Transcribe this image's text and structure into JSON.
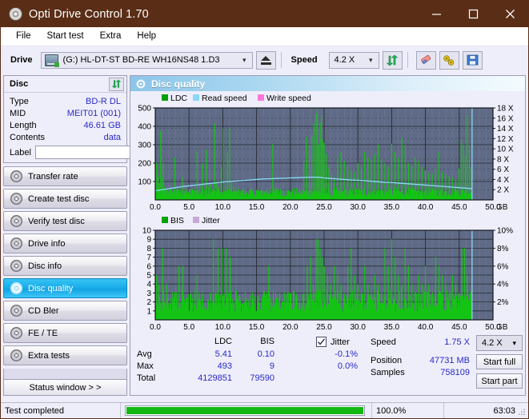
{
  "window": {
    "title": "Opti Drive Control 1.70",
    "icon": "disc-icon",
    "minimize": "minimize",
    "maximize": "maximize",
    "close": "close"
  },
  "menu": {
    "items": [
      "File",
      "Start test",
      "Extra",
      "Help"
    ]
  },
  "toolbar": {
    "drive_label": "Drive",
    "drive_value": "(G:)   HL-DT-ST BD-RE  WH16NS48 1.D3",
    "eject_icon": "eject-icon",
    "speed_label": "Speed",
    "speed_value": "4.2 X",
    "refresh_icon": "refresh-icon",
    "erase_icon": "eraser-icon",
    "tools_icon": "wrench-icon",
    "save_icon": "floppy-save-icon"
  },
  "disc_panel": {
    "title": "Disc",
    "refresh_icon": "refresh-icon",
    "rows": [
      {
        "key": "Type",
        "value": "BD-R DL"
      },
      {
        "key": "MID",
        "value": "MEIT01 (001)"
      },
      {
        "key": "Length",
        "value": "46.61 GB"
      },
      {
        "key": "Contents",
        "value": "data"
      }
    ],
    "label_key": "Label",
    "label_value": "",
    "label_placeholder": "",
    "disc_icon": "cd-icon"
  },
  "nav": {
    "items": [
      {
        "label": "Transfer rate",
        "selected": false
      },
      {
        "label": "Create test disc",
        "selected": false
      },
      {
        "label": "Verify test disc",
        "selected": false
      },
      {
        "label": "Drive info",
        "selected": false
      },
      {
        "label": "Disc info",
        "selected": false
      },
      {
        "label": "Disc quality",
        "selected": true
      },
      {
        "label": "CD Bler",
        "selected": false
      },
      {
        "label": "FE / TE",
        "selected": false
      },
      {
        "label": "Extra tests",
        "selected": false
      }
    ],
    "status_window": "Status window > >"
  },
  "content": {
    "title": "Disc quality",
    "icon": "disc-quality-icon"
  },
  "stats": {
    "col_ldc": "LDC",
    "col_bis": "BIS",
    "rows": [
      {
        "label": "Avg",
        "ldc": "5.41",
        "bis": "0.10"
      },
      {
        "label": "Max",
        "ldc": "493",
        "bis": "9"
      },
      {
        "label": "Total",
        "ldc": "4129851",
        "bis": "79590"
      }
    ],
    "jitter_label": "Jitter",
    "jitter_checked": true,
    "jitter_values": [
      "-0.1%",
      "0.0%"
    ],
    "speed_label": "Speed",
    "speed_value": "1.75 X",
    "position_label": "Position",
    "position_value": "47731 MB",
    "samples_label": "Samples",
    "samples_value": "758109",
    "speed_select": "4.2 X",
    "start_full": "Start full",
    "start_part": "Start part"
  },
  "statusbar": {
    "message": "Test completed",
    "progress_pct": 100.0,
    "progress_text": "100.0%",
    "elapsed": "63:03"
  },
  "colors": {
    "title_bar": "#5a2d16",
    "accent_selected": "#1aaeea",
    "value_blue": "#2929c8",
    "plot_bg": "#5f6b86",
    "series_green": "#14c414",
    "series_cyan": "#88d8f8",
    "series_pink": "#ff77dd",
    "jitter_violet": "#c9a8d8",
    "progress_green": "#12b812"
  },
  "chart_data": [
    {
      "type": "area",
      "name": "quality-chart-ldc",
      "title": "",
      "xlabel": "GB",
      "ylabel": "",
      "xlim": [
        0,
        50
      ],
      "ylim": [
        0,
        500
      ],
      "y2lim": [
        0,
        18
      ],
      "grid": true,
      "xticks": [
        0.0,
        5.0,
        10.0,
        15.0,
        20.0,
        25.0,
        30.0,
        35.0,
        40.0,
        45.0,
        50.0
      ],
      "xticklabels": [
        "0.0",
        "5.0",
        "10.0",
        "15.0",
        "20.0",
        "25.0",
        "30.0",
        "35.0",
        "40.0",
        "45.0",
        "50.0"
      ],
      "xunit": "GB",
      "yticks": [
        100,
        200,
        300,
        400,
        500
      ],
      "yticklabels": [
        "100",
        "200",
        "300",
        "400",
        "500"
      ],
      "y2ticks": [
        2,
        4,
        6,
        8,
        10,
        12,
        14,
        16,
        18
      ],
      "y2ticklabels": [
        "2 X",
        "4 X",
        "6 X",
        "8 X",
        "10 X",
        "12 X",
        "14 X",
        "16 X",
        "18 X"
      ],
      "legend": [
        {
          "label": "LDC",
          "color": "#00a000"
        },
        {
          "label": "Read speed",
          "color": "#88d8f8"
        },
        {
          "label": "Write speed",
          "color": "#ff77dd"
        }
      ],
      "legend_position": "top-left",
      "data_end_x": 46.9,
      "series": [
        {
          "name": "LDC",
          "color": "#14c414",
          "type": "spikes",
          "baseline": 20,
          "x": [
            0.2,
            0.4,
            0.6,
            0.8,
            1.0,
            1.2,
            1.4,
            1.6,
            1.8,
            2.0,
            2.3,
            2.6,
            2.9,
            3.2,
            3.5,
            3.8,
            4.1,
            4.4,
            4.7,
            5.0,
            5.4,
            5.8,
            6.2,
            6.6,
            7.0,
            7.3,
            7.6,
            7.9,
            8.2,
            8.5,
            8.8,
            9.1,
            9.3,
            9.5,
            9.8,
            10.1,
            10.4,
            10.7,
            11.0,
            11.3,
            11.6,
            11.9,
            12.2,
            12.6,
            13.0,
            13.5,
            14.0,
            14.5,
            15.0,
            15.4,
            15.8,
            16.2,
            16.6,
            17.0,
            17.4,
            17.8,
            18.2,
            18.6,
            19.0,
            19.5,
            20.0,
            20.4,
            20.8,
            21.2,
            21.6,
            22.0,
            22.4,
            22.8,
            23.2,
            23.5,
            23.8,
            24.0,
            24.2,
            24.4,
            24.6,
            24.8,
            25.0,
            25.3,
            25.7,
            26.1,
            26.5,
            27.0,
            27.5,
            28.0,
            28.5,
            29.0,
            29.5,
            30.0,
            30.5,
            31.0,
            31.5,
            32.0,
            32.5,
            33.0,
            33.5,
            34.0,
            34.5,
            35.0,
            35.5,
            36.0,
            36.5,
            37.0,
            37.5,
            38.0,
            38.5,
            39.0,
            39.5,
            40.0,
            40.5,
            41.0,
            41.5,
            42.0,
            42.5,
            43.0,
            43.5,
            44.0,
            44.5,
            45.0,
            45.3,
            45.6,
            45.9,
            46.2,
            46.5,
            46.8
          ],
          "y": [
            200,
            130,
            90,
            375,
            120,
            200,
            70,
            60,
            55,
            50,
            48,
            45,
            230,
            60,
            50,
            45,
            120,
            55,
            50,
            45,
            60,
            55,
            260,
            80,
            200,
            60,
            270,
            70,
            90,
            60,
            415,
            100,
            70,
            60,
            180,
            390,
            70,
            260,
            395,
            95,
            70,
            60,
            55,
            50,
            45,
            40,
            38,
            36,
            55,
            50,
            48,
            45,
            60,
            55,
            305,
            70,
            60,
            55,
            50,
            48,
            45,
            42,
            40,
            38,
            36,
            210,
            340,
            300,
            350,
            420,
            470,
            495,
            300,
            420,
            460,
            330,
            310,
            250,
            180,
            140,
            120,
            230,
            260,
            210,
            180,
            160,
            150,
            200,
            180,
            260,
            230,
            220,
            250,
            300,
            220,
            200,
            180,
            305,
            260,
            230,
            340,
            300,
            200,
            180,
            230,
            210,
            180,
            160,
            150,
            140,
            170,
            260,
            150,
            140,
            130,
            120,
            110,
            170,
            330,
            300,
            240,
            460,
            300,
            180
          ]
        },
        {
          "name": "Read speed",
          "color": "#88d8f8",
          "type": "line",
          "axis": "y2",
          "x": [
            0.0,
            1.0,
            2.0,
            3.0,
            4.0,
            5.0,
            6.0,
            7.0,
            8.0,
            9.0,
            10.0,
            11.0,
            12.0,
            13.0,
            14.0,
            15.0,
            16.0,
            17.0,
            18.0,
            19.0,
            20.0,
            21.0,
            22.0,
            23.0,
            23.8,
            24.5,
            25.0,
            26.0,
            27.0,
            28.0,
            29.0,
            30.0,
            31.0,
            32.0,
            33.0,
            34.0,
            35.0,
            36.0,
            37.0,
            38.0,
            39.0,
            40.0,
            41.0,
            42.0,
            43.0,
            44.0,
            45.0,
            46.0,
            46.8
          ],
          "y": [
            1.8,
            2.0,
            2.2,
            2.4,
            2.6,
            2.75,
            2.9,
            3.05,
            3.2,
            3.35,
            3.5,
            3.6,
            3.7,
            3.8,
            3.9,
            4.0,
            4.1,
            4.15,
            4.2,
            4.25,
            4.3,
            4.35,
            4.4,
            4.45,
            4.45,
            4.4,
            4.3,
            4.2,
            4.1,
            4.0,
            3.9,
            3.85,
            3.75,
            3.65,
            3.55,
            3.45,
            3.4,
            3.3,
            3.2,
            3.1,
            3.0,
            2.9,
            2.8,
            2.7,
            2.6,
            2.5,
            2.4,
            2.3,
            2.2
          ]
        },
        {
          "name": "end-marker",
          "color": "#88d8f8",
          "type": "vline",
          "x": 46.9
        }
      ]
    },
    {
      "type": "area",
      "name": "quality-chart-bis",
      "title": "",
      "xlabel": "GB",
      "ylabel": "",
      "xlim": [
        0,
        50
      ],
      "ylim": [
        0,
        10
      ],
      "y2lim": [
        0,
        10
      ],
      "grid": true,
      "xticks": [
        0.0,
        5.0,
        10.0,
        15.0,
        20.0,
        25.0,
        30.0,
        35.0,
        40.0,
        45.0,
        50.0
      ],
      "xticklabels": [
        "0.0",
        "5.0",
        "10.0",
        "15.0",
        "20.0",
        "25.0",
        "30.0",
        "35.0",
        "40.0",
        "45.0",
        "50.0"
      ],
      "xunit": "GB",
      "yticks": [
        1,
        2,
        3,
        4,
        5,
        6,
        7,
        8,
        9,
        10
      ],
      "yticklabels": [
        "1",
        "2",
        "3",
        "4",
        "5",
        "6",
        "7",
        "8",
        "9",
        "10"
      ],
      "y2ticks": [
        2,
        4,
        6,
        8,
        10
      ],
      "y2ticklabels": [
        "2%",
        "4%",
        "6%",
        "8%",
        "10%"
      ],
      "legend": [
        {
          "label": "BIS",
          "color": "#00a000"
        },
        {
          "label": "Jitter",
          "color": "#c9a8d8"
        }
      ],
      "legend_position": "top-left",
      "data_end_x": 46.9,
      "series": [
        {
          "name": "BIS",
          "color": "#14c414",
          "type": "spikes",
          "baseline": 1,
          "x": [
            0.2,
            0.5,
            0.8,
            1.1,
            1.4,
            1.7,
            2.0,
            2.3,
            2.6,
            2.9,
            3.2,
            3.5,
            3.8,
            4.1,
            4.4,
            4.7,
            5.0,
            5.4,
            5.8,
            6.2,
            6.6,
            7.0,
            7.4,
            7.8,
            8.2,
            8.6,
            9.0,
            9.3,
            9.6,
            9.9,
            10.2,
            10.5,
            10.8,
            11.1,
            11.4,
            11.7,
            12.0,
            12.4,
            12.8,
            13.2,
            13.6,
            14.0,
            14.4,
            14.8,
            15.2,
            15.6,
            16.0,
            16.4,
            16.8,
            17.2,
            17.6,
            18.0,
            18.4,
            18.8,
            19.2,
            19.6,
            20.0,
            20.5,
            21.0,
            21.5,
            22.0,
            22.5,
            23.0,
            23.4,
            23.8,
            24.1,
            24.4,
            24.7,
            25.0,
            25.5,
            26.0,
            26.5,
            27.0,
            27.5,
            28.0,
            28.5,
            29.0,
            29.5,
            30.0,
            30.5,
            31.0,
            31.5,
            32.0,
            32.5,
            33.0,
            33.5,
            34.0,
            34.5,
            35.0,
            35.5,
            36.0,
            36.5,
            37.0,
            37.5,
            38.0,
            38.5,
            39.0,
            39.5,
            40.0,
            40.5,
            41.0,
            41.5,
            42.0,
            42.5,
            43.0,
            43.5,
            44.0,
            44.5,
            45.0,
            45.4,
            45.8,
            46.2,
            46.6,
            46.8
          ],
          "y": [
            5,
            4,
            2,
            8,
            2,
            4,
            1,
            1,
            1,
            1,
            1,
            6,
            2,
            6,
            2,
            1,
            1,
            1,
            1,
            5,
            2,
            3,
            2,
            2,
            3,
            9,
            3,
            8,
            2,
            8,
            3,
            8,
            2,
            7,
            2,
            1,
            1,
            2,
            1,
            2,
            1,
            2,
            1,
            1,
            2,
            1,
            3,
            2,
            6,
            2,
            1,
            2,
            3,
            1,
            2,
            1,
            2,
            1,
            2,
            1,
            3,
            6,
            7,
            4,
            9,
            9,
            8,
            7,
            6,
            5,
            4,
            6,
            5,
            4,
            3,
            6,
            8,
            5,
            4,
            3,
            6,
            4,
            3,
            5,
            4,
            3,
            8,
            6,
            9,
            7,
            5,
            4,
            8,
            6,
            4,
            3,
            5,
            4,
            6,
            4,
            3,
            7,
            6,
            5,
            4,
            3,
            5,
            4,
            3,
            8,
            8,
            5,
            3,
            2
          ]
        },
        {
          "name": "end-marker",
          "color": "#88d8f8",
          "type": "vline",
          "x": 46.9
        }
      ]
    }
  ]
}
